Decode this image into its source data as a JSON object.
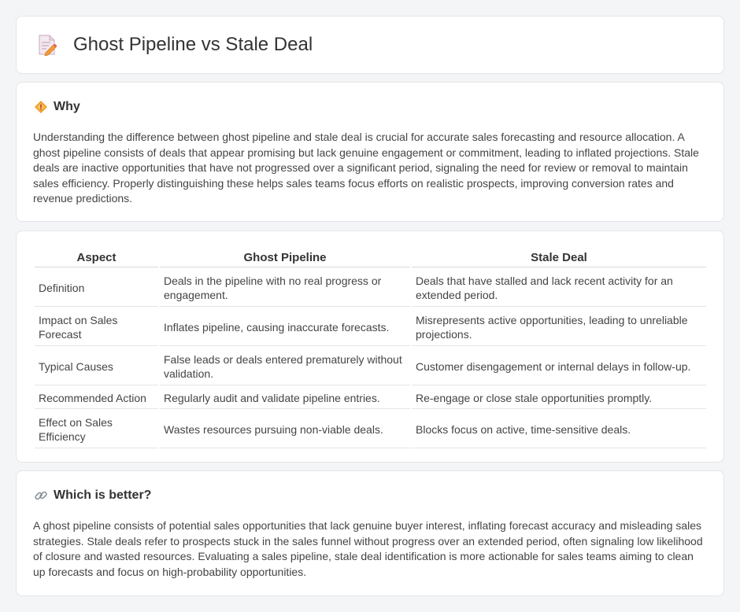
{
  "header": {
    "title": "Ghost Pipeline vs Stale Deal",
    "icon": "document-pencil-icon"
  },
  "why": {
    "heading": "Why",
    "icon": "diamond-warning-icon",
    "text": "Understanding the difference between ghost pipeline and stale deal is crucial for accurate sales forecasting and resource allocation. A ghost pipeline consists of deals that appear promising but lack genuine engagement or commitment, leading to inflated projections. Stale deals are inactive opportunities that have not progressed over a significant period, signaling the need for review or removal to maintain sales efficiency. Properly distinguishing these helps sales teams focus efforts on realistic prospects, improving conversion rates and revenue predictions."
  },
  "table": {
    "headers": [
      "Aspect",
      "Ghost Pipeline",
      "Stale Deal"
    ],
    "rows": [
      [
        "Definition",
        "Deals in the pipeline with no real progress or engagement.",
        "Deals that have stalled and lack recent activity for an extended period."
      ],
      [
        "Impact on Sales Forecast",
        "Inflates pipeline, causing inaccurate forecasts.",
        "Misrepresents active opportunities, leading to unreliable projections."
      ],
      [
        "Typical Causes",
        "False leads or deals entered prematurely without validation.",
        "Customer disengagement or internal delays in follow-up."
      ],
      [
        "Recommended Action",
        "Regularly audit and validate pipeline entries.",
        "Re-engage or close stale opportunities promptly."
      ],
      [
        "Effect on Sales Efficiency",
        "Wastes resources pursuing non-viable deals.",
        "Blocks focus on active, time-sensitive deals."
      ]
    ]
  },
  "better": {
    "heading": "Which is better?",
    "icon": "link-icon",
    "text": "A ghost pipeline consists of potential sales opportunities that lack genuine buyer interest, inflating forecast accuracy and misleading sales strategies. Stale deals refer to prospects stuck in the sales funnel without progress over an extended period, often signaling low likelihood of closure and wasted resources. Evaluating a sales pipeline, stale deal identification is more actionable for sales teams aiming to clean up forecasts and focus on high-probability opportunities."
  },
  "colors": {
    "background": "#f4f5f7",
    "card": "#ffffff",
    "icon_orange": "#f0a030",
    "icon_pink": "#e06070"
  }
}
